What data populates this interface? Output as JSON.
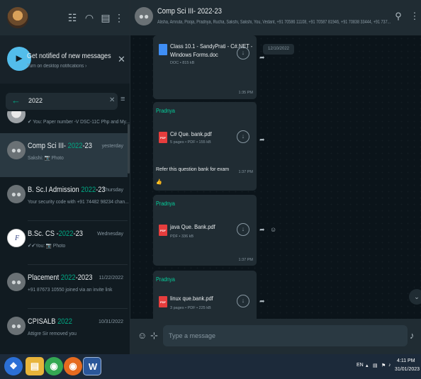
{
  "left_header": {
    "icons": [
      "communities-icon",
      "status-icon",
      "new-chat-icon",
      "menu-icon"
    ]
  },
  "notification": {
    "title": "Get notified of new messages",
    "subtitle": "Turn on desktop notifications ›"
  },
  "search": {
    "value": "2022"
  },
  "chats": [
    {
      "name_pre": "",
      "name_hl": "",
      "name_post": "",
      "time": "",
      "message": "✔ You: Paper number -V DSC-11C  Php and My..."
    },
    {
      "name_pre": "Comp Sci III- ",
      "name_hl": "2022",
      "name_post": "-23",
      "time": "yesterday",
      "message": "Sakshi: 📷 Photo"
    },
    {
      "name_pre": "B. Sc.I Admission ",
      "name_hl": "2022",
      "name_post": "-23",
      "time": "Thursday",
      "message": "Your security code with +91 74482 98234 chan..."
    },
    {
      "name_pre": "B.Sc. CS -",
      "name_hl": "2022",
      "name_post": "-23",
      "time": "Wednesday",
      "message": "✔✔You: 📷 Photo"
    },
    {
      "name_pre": "Placement ",
      "name_hl": "2022",
      "name_post": "-2023",
      "time": "11/22/2022",
      "message": "+91 87673 10550 joined via an invite link"
    },
    {
      "name_pre": "CPISALB ",
      "name_hl": "2022",
      "name_post": "",
      "time": "10/31/2022",
      "message": "Attigre Sir removed you"
    }
  ],
  "conversation": {
    "title": "Comp Sci III- 2022-23",
    "members": "Alisha, Amruta, Pooja, Pradnya, Rucha, Sakshi, Sakshi, You, Vedant, +91 70586 11108, +91 70587 81946, +91 70838 33444, +91 737..."
  },
  "messages": {
    "date_chip": "12/10/2022",
    "m1": {
      "doc_name_1": "Class 10.1 - SandyPrati - C#.NET -",
      "doc_name_2": "Windows Forms.doc",
      "meta": "DOC • 815 kB",
      "time": "1:35 PM"
    },
    "m2": {
      "sender": "Pradnya",
      "doc_name": "C# Que. bank.pdf",
      "meta": "5 pages • PDF • 155 kB",
      "caption": "Refer this question bank for exam",
      "time": "1:37 PM",
      "reaction": "👍"
    },
    "m3": {
      "sender": "Pradnya",
      "doc_name": "java Que. Bank.pdf",
      "meta": "PDF • 336 kB",
      "time": "1:37 PM"
    },
    "m4": {
      "sender": "Pradnya",
      "doc_name": "linux que.bank.pdf",
      "meta": "3 pages • PDF • 225 kB"
    }
  },
  "composer": {
    "placeholder": "Type a message"
  },
  "taskbar": {
    "word_label": "W",
    "lang": "EN",
    "time": "4:11 PM",
    "date": "31/01/2023"
  },
  "colors": {
    "accent": "#00a884",
    "panel": "#111b21",
    "header": "#202c33"
  }
}
